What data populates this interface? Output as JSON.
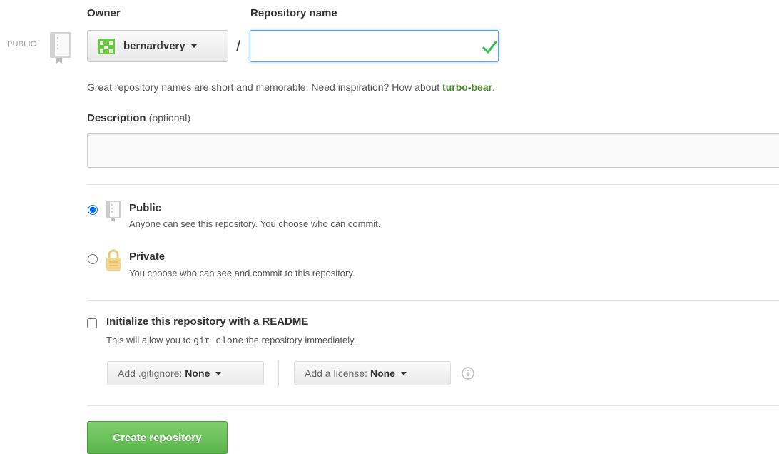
{
  "header": {
    "visibility_tag": "PUBLIC",
    "owner_label": "Owner",
    "repo_name_label": "Repository name"
  },
  "owner": {
    "name": "bernardvery"
  },
  "separator": "/",
  "repo_name": {
    "value": "",
    "valid": true
  },
  "help": {
    "prefix": "Great repository names are short and memorable. Need inspiration? How about ",
    "suggestion": "turbo-bear",
    "suffix": "."
  },
  "description": {
    "label": "Description",
    "optional": "(optional)",
    "value": ""
  },
  "visibility": {
    "selected": "public",
    "options": [
      {
        "id": "public",
        "title": "Public",
        "desc": "Anyone can see this repository. You choose who can commit."
      },
      {
        "id": "private",
        "title": "Private",
        "desc": "You choose who can see and commit to this repository."
      }
    ]
  },
  "init": {
    "checked": false,
    "title": "Initialize this repository with a README",
    "desc_prefix": "This will allow you to ",
    "desc_code": "git clone",
    "desc_suffix": " the repository immediately."
  },
  "gitignore": {
    "label": "Add .gitignore:",
    "value": "None"
  },
  "license": {
    "label": "Add a license:",
    "value": "None"
  },
  "submit": {
    "label": "Create repository"
  },
  "colors": {
    "accent_blue": "#51a7e8",
    "success_green": "#5ab34a",
    "suggestion_green": "#4a8b2c"
  },
  "icons": [
    "repo-book-icon",
    "owner-avatar-icon",
    "caret-down-icon",
    "check-icon",
    "lock-icon",
    "info-icon"
  ]
}
